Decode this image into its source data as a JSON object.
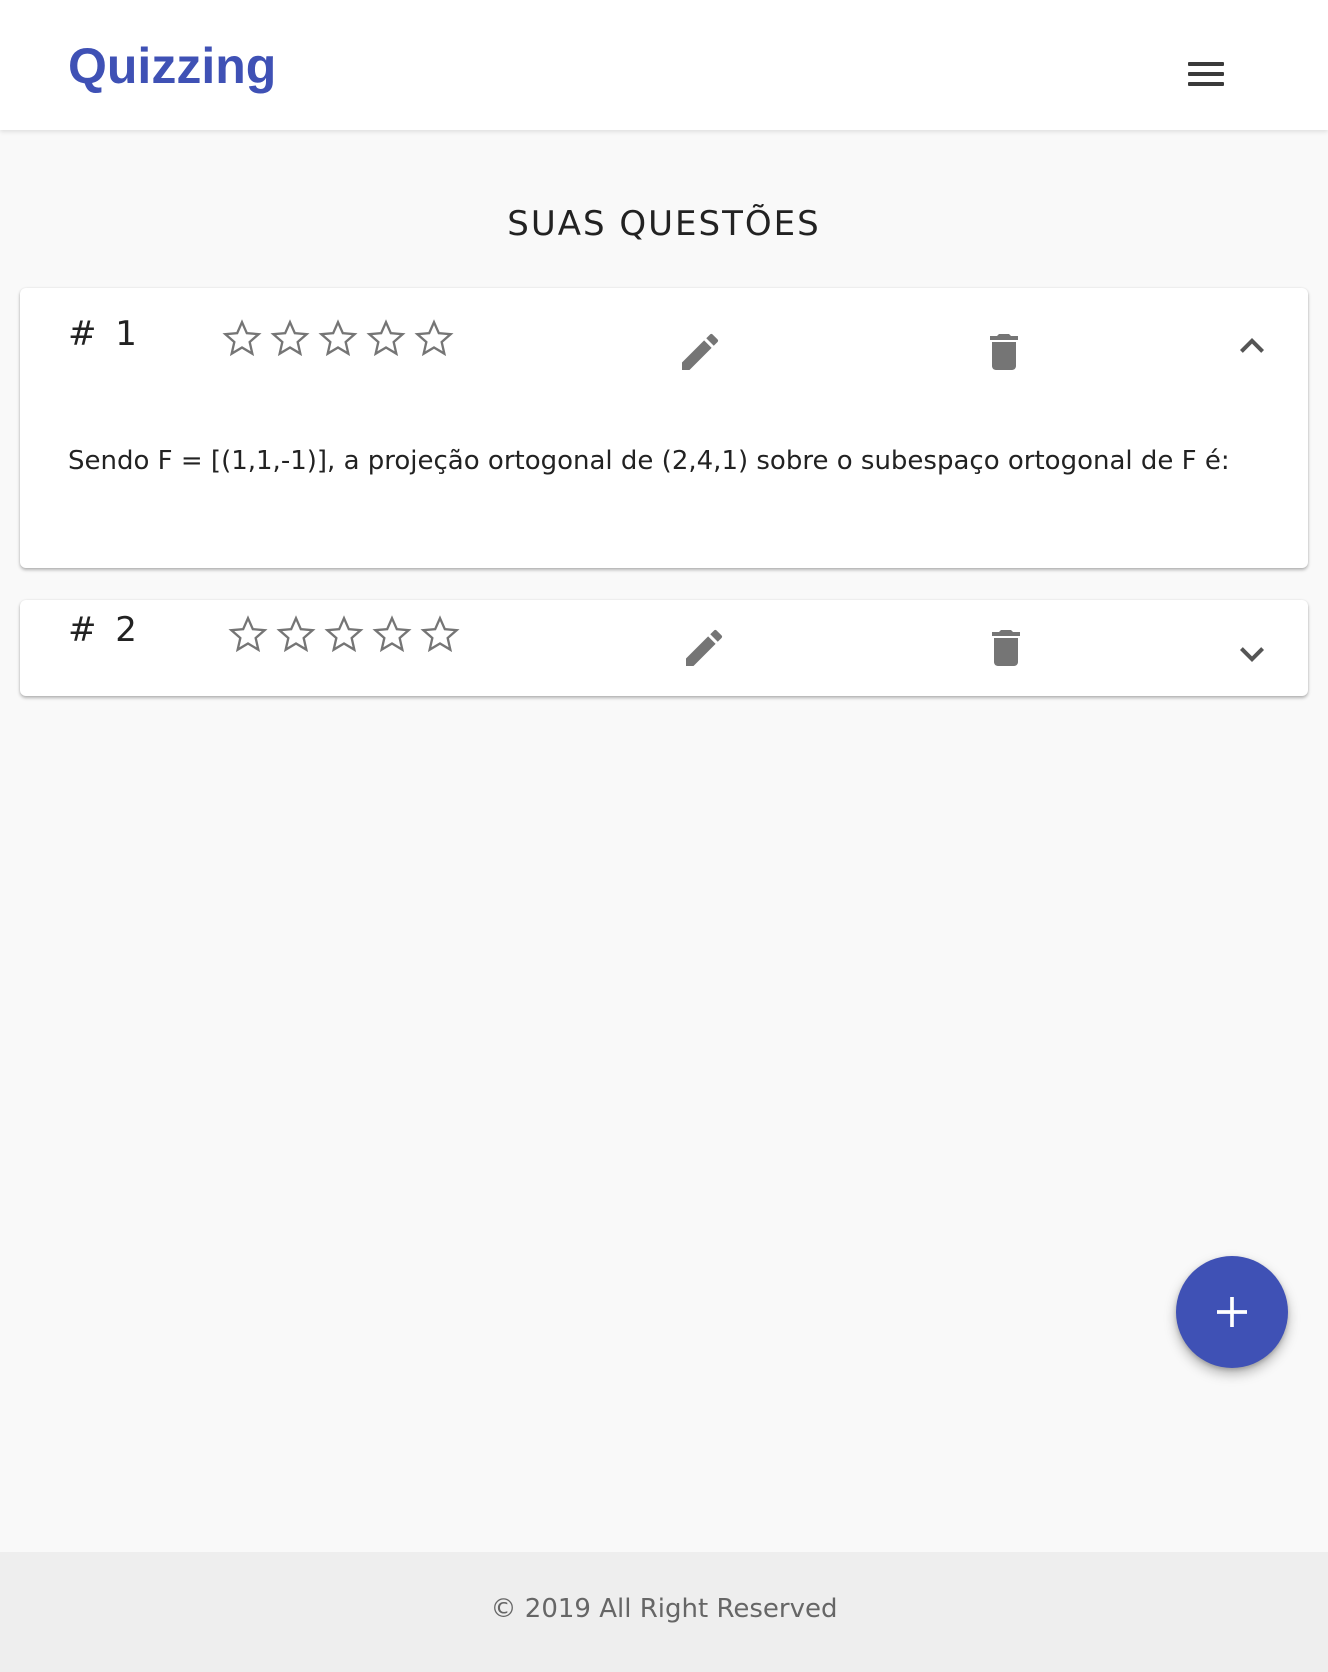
{
  "header": {
    "brand": "Quizzing",
    "menu_icon": "hamburger-menu-icon"
  },
  "page": {
    "title": "SUAS QUESTÕES"
  },
  "questions": [
    {
      "number": "# 1",
      "rating": 0,
      "rating_max": 5,
      "expanded": true,
      "text": "Sendo F = [(1,1,-1)], a projeção ortogonal de (2,4,1) sobre o subespaço ortogonal de F é:",
      "edit_icon": "pencil-icon",
      "delete_icon": "trash-icon",
      "toggle_icon": "chevron-up-icon"
    },
    {
      "number": "# 2",
      "rating": 0,
      "rating_max": 5,
      "expanded": false,
      "text": "",
      "edit_icon": "pencil-icon",
      "delete_icon": "trash-icon",
      "toggle_icon": "chevron-down-icon"
    }
  ],
  "fab": {
    "icon": "plus-icon"
  },
  "footer": {
    "text": "© 2019 All Right Reserved"
  },
  "colors": {
    "primary": "#3f51b5",
    "icon_gray": "#757575",
    "background": "#f9f9f9",
    "footer_bg": "#eeeeee"
  }
}
